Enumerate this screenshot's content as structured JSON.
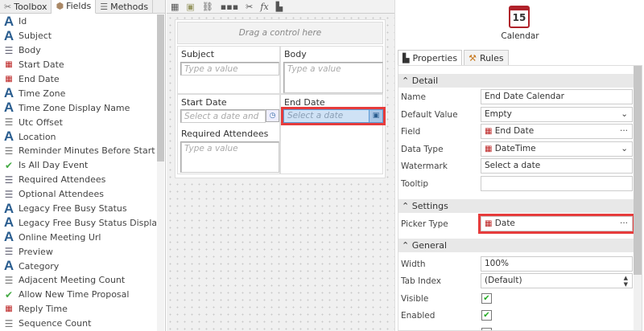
{
  "left": {
    "tabs": [
      {
        "label": "Toolbox",
        "icon": "wrench-icon"
      },
      {
        "label": "Fields",
        "icon": "fields-icon"
      },
      {
        "label": "Methods",
        "icon": "methods-icon"
      }
    ],
    "fields": [
      {
        "label": "Id",
        "type": "text"
      },
      {
        "label": "Subject",
        "type": "text"
      },
      {
        "label": "Body",
        "type": "body"
      },
      {
        "label": "Start Date",
        "type": "datetime"
      },
      {
        "label": "End Date",
        "type": "datetime"
      },
      {
        "label": "Time Zone",
        "type": "text"
      },
      {
        "label": "Time Zone Display Name",
        "type": "text"
      },
      {
        "label": "Utc Offset",
        "type": "number"
      },
      {
        "label": "Location",
        "type": "text"
      },
      {
        "label": "Reminder Minutes Before Start",
        "type": "number"
      },
      {
        "label": "Is All Day Event",
        "type": "bool"
      },
      {
        "label": "Required Attendees",
        "type": "body"
      },
      {
        "label": "Optional Attendees",
        "type": "body"
      },
      {
        "label": "Legacy Free Busy Status",
        "type": "text"
      },
      {
        "label": "Legacy Free Busy Status Display Na...",
        "type": "text"
      },
      {
        "label": "Online Meeting Url",
        "type": "text"
      },
      {
        "label": "Preview",
        "type": "body"
      },
      {
        "label": "Category",
        "type": "text"
      },
      {
        "label": "Adjacent Meeting Count",
        "type": "number"
      },
      {
        "label": "Allow New Time Proposal",
        "type": "bool"
      },
      {
        "label": "Reply Time",
        "type": "datetime"
      },
      {
        "label": "Sequence Count",
        "type": "number"
      }
    ]
  },
  "canvas": {
    "drag_hint": "Drag a control here",
    "subject": {
      "label": "Subject",
      "placeholder": "Type a value"
    },
    "body": {
      "label": "Body",
      "placeholder": "Type a value"
    },
    "start_date": {
      "label": "Start Date",
      "placeholder": "Select a date and"
    },
    "end_date": {
      "label": "End Date",
      "placeholder": "Select a date"
    },
    "required_attendees": {
      "label": "Required Attendees",
      "placeholder": "Type a value"
    }
  },
  "right": {
    "control": {
      "icon_day": "15",
      "name": "Calendar"
    },
    "tabs": [
      "Properties",
      "Rules"
    ],
    "sections": {
      "detail": "Detail",
      "settings": "Settings",
      "general": "General"
    },
    "props": {
      "name": {
        "label": "Name",
        "value": "End Date Calendar"
      },
      "default_value": {
        "label": "Default Value",
        "value": "Empty"
      },
      "field": {
        "label": "Field",
        "value": "End Date"
      },
      "data_type": {
        "label": "Data Type",
        "value": "DateTime"
      },
      "watermark": {
        "label": "Watermark",
        "value": "Select a date"
      },
      "tooltip": {
        "label": "Tooltip",
        "value": ""
      },
      "picker_type": {
        "label": "Picker Type",
        "value": "Date"
      },
      "width": {
        "label": "Width",
        "value": "100%"
      },
      "tab_index": {
        "label": "Tab Index",
        "value": "(Default)"
      },
      "visible": {
        "label": "Visible",
        "checked": true
      },
      "enabled": {
        "label": "Enabled",
        "checked": true
      }
    },
    "ellipsis": "···"
  },
  "colors": {
    "highlight": "#e63c3c",
    "calendar_red": "#b0222a"
  }
}
